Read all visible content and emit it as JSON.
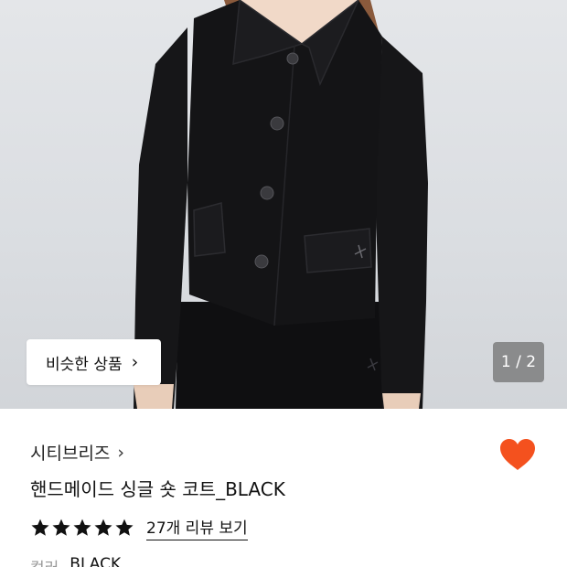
{
  "gallery": {
    "similar_products_label": "비슷한 상품",
    "counter": "1 / 2",
    "current_index": 1,
    "total": 2
  },
  "product": {
    "brand": "시티브리즈",
    "title": "핸드메이드 싱글 숏 코트_BLACK",
    "rating_stars": 5,
    "review_link": "27개 리뷰 보기",
    "liked": true,
    "option_label": "컬러",
    "option_value": "BLACK"
  },
  "colors": {
    "heart": "#f4511e",
    "star": "#111111",
    "background": "#ffffff",
    "hero_bg": "#dcdfe2",
    "coat": "#141416"
  },
  "icons": {
    "chevron": "chevron-right-icon",
    "heart": "heart-icon",
    "star": "star-icon"
  }
}
